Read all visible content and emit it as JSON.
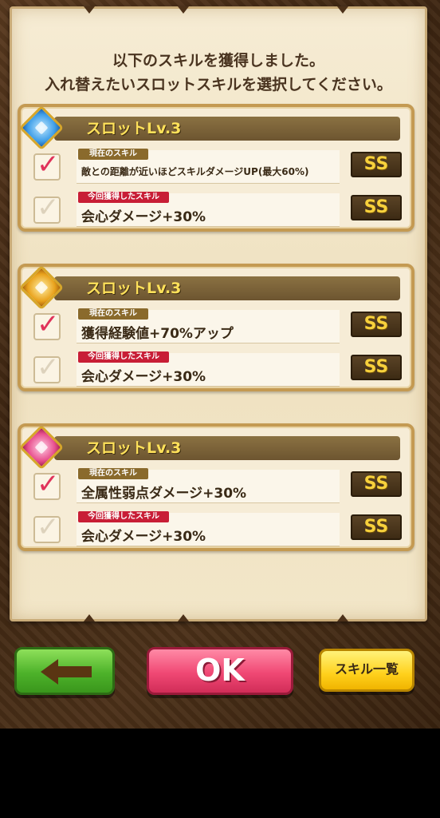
{
  "message": {
    "line1": "以下のスキルを獲得しました。",
    "line2": "入れ替えたいスロットスキルを選択してください。"
  },
  "slots": [
    {
      "title": "スロットLv.3",
      "gem_color": "blue",
      "current": {
        "tag": "現在のスキル",
        "skill": "敵との距離が近いほどスキルダメージUP(最大60%)",
        "rank": "SS",
        "checked": true
      },
      "new": {
        "tag": "今回獲得したスキル",
        "skill": "会心ダメージ+30%",
        "rank": "SS",
        "checked": false
      }
    },
    {
      "title": "スロットLv.3",
      "gem_color": "gold",
      "current": {
        "tag": "現在のスキル",
        "skill": "獲得経験値+70%アップ",
        "rank": "SS",
        "checked": true
      },
      "new": {
        "tag": "今回獲得したスキル",
        "skill": "会心ダメージ+30%",
        "rank": "SS",
        "checked": false
      }
    },
    {
      "title": "スロットLv.3",
      "gem_color": "pink",
      "current": {
        "tag": "現在のスキル",
        "skill": "全属性弱点ダメージ+30%",
        "rank": "SS",
        "checked": true
      },
      "new": {
        "tag": "今回獲得したスキル",
        "skill": "会心ダメージ+30%",
        "rank": "SS",
        "checked": false
      }
    }
  ],
  "buttons": {
    "back_icon": "arrow-left-icon",
    "ok_label": "OK",
    "skill_list_label": "スキル一覧"
  },
  "colors": {
    "accent_title": "#ffe15a",
    "checked": "#e0335a",
    "ok_button": "#f04874",
    "back_button": "#4db22a",
    "skill_list_button": "#ffd11c"
  }
}
